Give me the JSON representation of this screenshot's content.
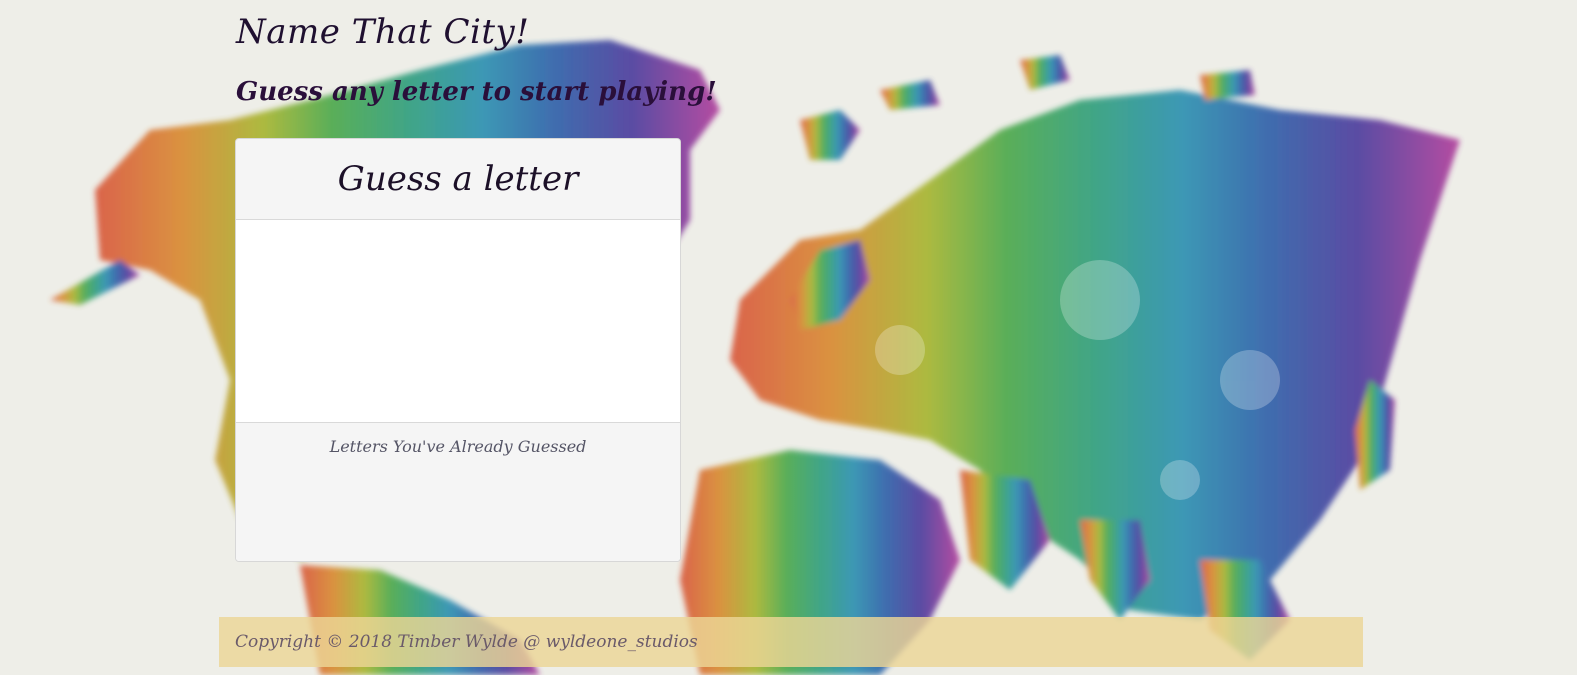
{
  "header": {
    "title": "Name That City!",
    "subtitle": "Guess any letter to start playing!"
  },
  "game_panel": {
    "heading": "Guess a letter",
    "current_word": "",
    "guessed_label": "Letters You've Already Guessed",
    "guessed_letters": ""
  },
  "footer": {
    "copyright": "Copyright © 2018 Timber Wylde @ wyldeone_studios"
  },
  "colors": {
    "background": "#eeeee8",
    "title_text": "#1f1030",
    "panel_heading_bg": "#f5f5f5",
    "footer_bg": "#ecd696"
  },
  "background_image": "watercolor-world-map"
}
